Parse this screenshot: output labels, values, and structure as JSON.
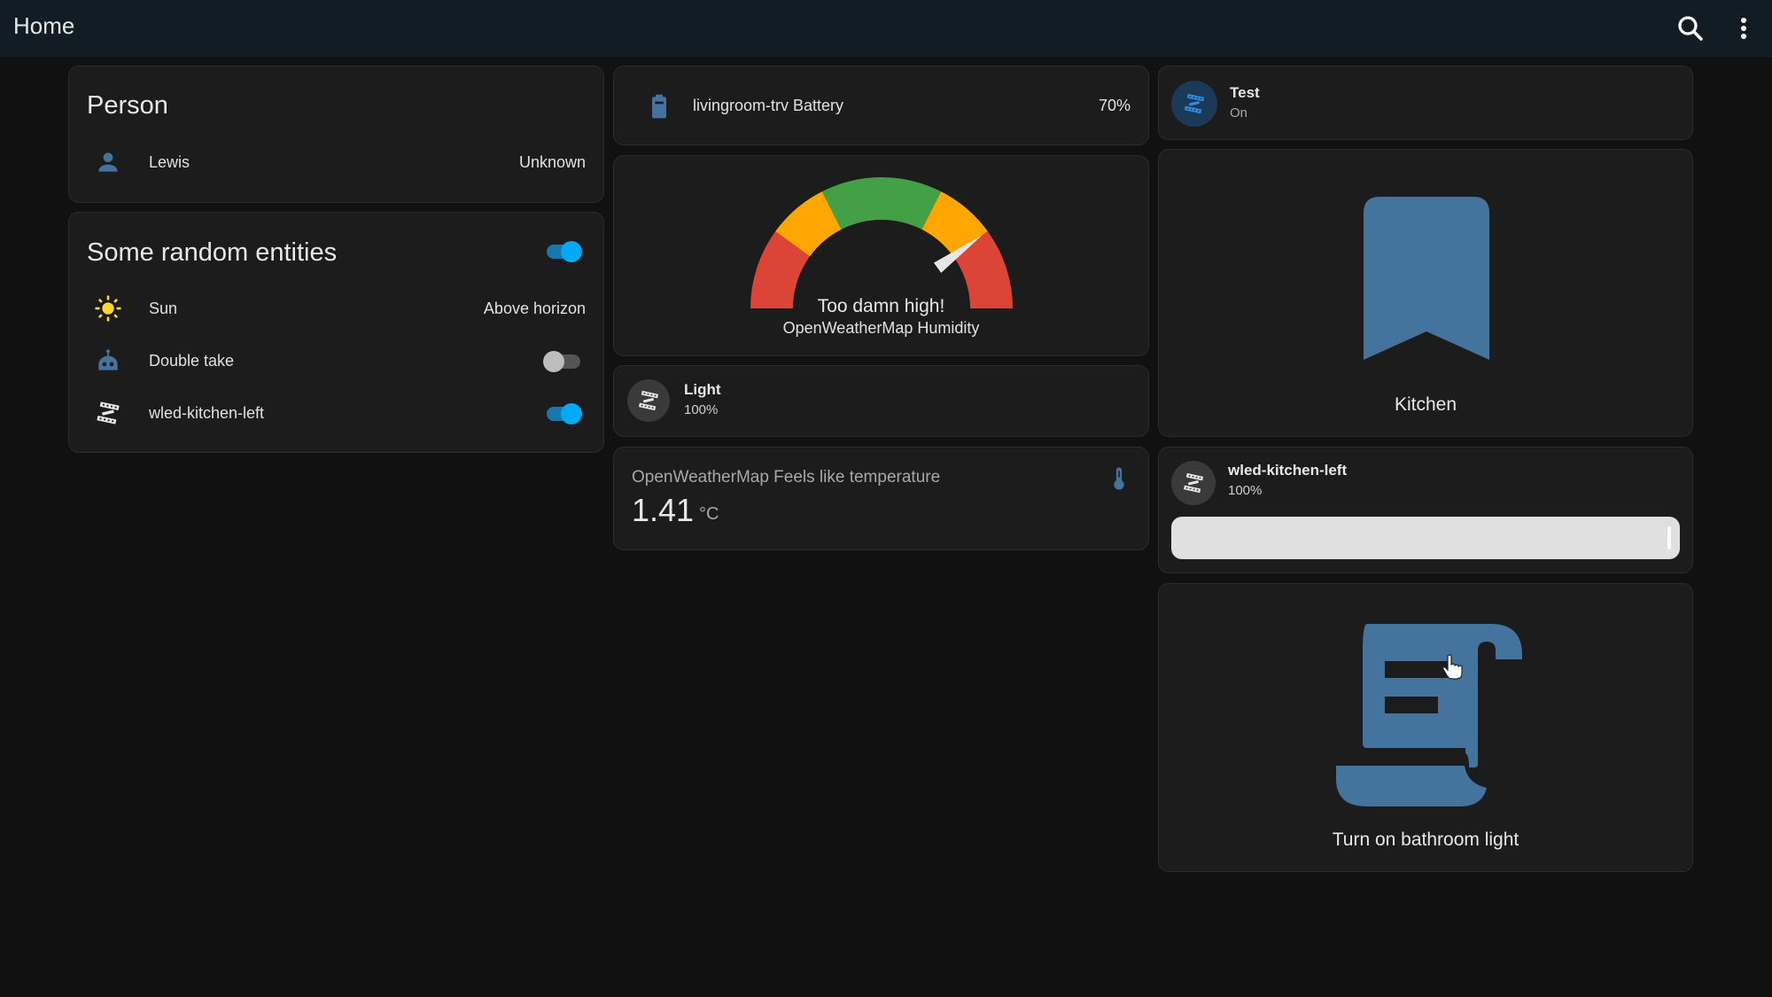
{
  "header": {
    "title": "Home",
    "search_icon": "search-icon",
    "menu_icon": "dots-vertical-icon"
  },
  "person_card": {
    "title": "Person",
    "rows": [
      {
        "icon": "account-icon",
        "name": "Lewis",
        "state": "Unknown"
      }
    ]
  },
  "entities_card": {
    "title": "Some random entities",
    "header_toggle": "on",
    "rows": [
      {
        "icon": "sun-icon",
        "name": "Sun",
        "state": "Above horizon"
      },
      {
        "icon": "robot-icon",
        "name": "Double take",
        "toggle": "off"
      },
      {
        "icon": "led-strip-icon",
        "name": "wled-kitchen-left",
        "toggle": "on"
      }
    ]
  },
  "battery_card": {
    "icon": "battery-icon",
    "name": "livingroom-trv Battery",
    "value": "70%"
  },
  "gauge_card": {
    "label": "Too damn high!",
    "name": "OpenWeatherMap Humidity",
    "needle_fraction": 0.8,
    "segments": [
      {
        "from": 0.0,
        "to": 0.2,
        "color": "#db4437"
      },
      {
        "from": 0.2,
        "to": 0.35,
        "color": "#ffa600"
      },
      {
        "from": 0.35,
        "to": 0.65,
        "color": "#43a047"
      },
      {
        "from": 0.65,
        "to": 0.8,
        "color": "#ffa600"
      },
      {
        "from": 0.8,
        "to": 1.0,
        "color": "#db4437"
      }
    ]
  },
  "light_tile": {
    "icon": "led-strip-icon",
    "name": "Light",
    "state": "100%"
  },
  "temperature_card": {
    "icon": "thermometer-icon",
    "name": "OpenWeatherMap Feels like temperature",
    "value": "1.41",
    "unit": "°C"
  },
  "test_tile": {
    "icon": "led-strip-icon",
    "name": "Test",
    "state": "On"
  },
  "kitchen_button": {
    "icon": "bookmark-icon",
    "label": "Kitchen"
  },
  "wled_tile": {
    "icon": "led-strip-icon",
    "name": "wled-kitchen-left",
    "state": "100%",
    "brightness_percent": 100
  },
  "script_button": {
    "icon": "script-icon",
    "label": "Turn on bathroom light"
  },
  "colors": {
    "accent": "#03a9f4",
    "icon_blue": "#44739e",
    "sun_yellow": "#fdd835"
  }
}
